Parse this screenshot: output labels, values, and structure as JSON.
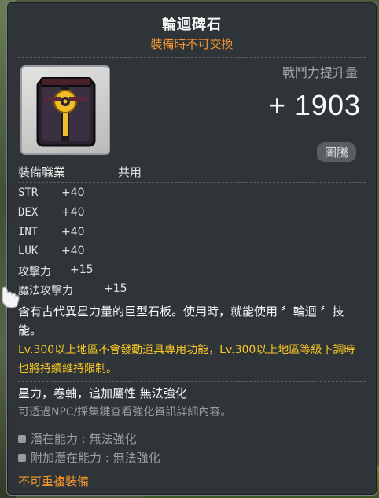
{
  "item": {
    "title": "輪迴碑石",
    "subtitle": "裝備時不可交換",
    "combat_power_label": "戰鬥力提升量",
    "combat_power_value": "+ 1903",
    "grade_badge": "圖騰",
    "job_label": "裝備職業",
    "job_value": "共用",
    "stats": [
      {
        "name": "STR",
        "value": "+40"
      },
      {
        "name": "DEX",
        "value": "+40"
      },
      {
        "name": "INT",
        "value": "+40"
      },
      {
        "name": "LUK",
        "value": "+40"
      },
      {
        "name": "攻擊力",
        "value": "+15"
      },
      {
        "name": "魔法攻擊力",
        "value": "+15"
      }
    ],
    "description": "含有古代異星力量的巨型石板。使用時，就能使用 〞輪迴 〞技能。",
    "restriction": "Lv.300以上地區不會發動道具專用功能，Lv.300以上地區等級下調時也將持續維持限制。",
    "star_line": "星力，卷軸，追加屬性 無法強化",
    "hint_line": "可透過NPC/採集鍵查看強化資訊詳細內容。",
    "potential": "潛在能力 : 無法強化",
    "additional_potential": "附加潛在能力 : 無法強化",
    "no_repeat": "不可重複裝備"
  },
  "icons": {
    "item_icon": "totem-stone-icon",
    "cursor": "glove-cursor-icon",
    "bullet": "square-bullet-icon"
  },
  "colors": {
    "title": "#ffffff",
    "warning_orange": "#ff9a2e",
    "restriction_yellow": "#ffcc22",
    "muted": "#9aa0a6",
    "tooltip_bg": "#2f3338"
  }
}
